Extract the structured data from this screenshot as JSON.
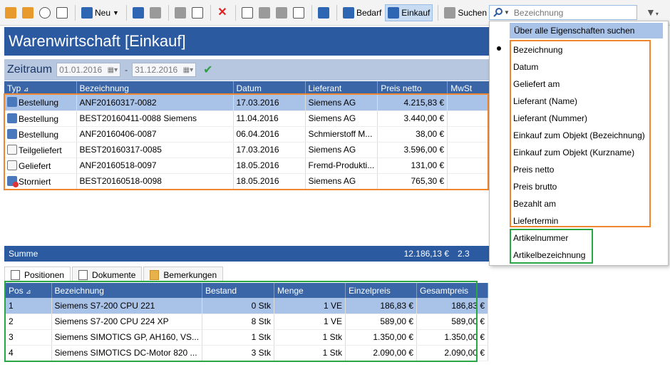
{
  "toolbar": {
    "new_label": "Neu",
    "bedarf_label": "Bedarf",
    "einkauf_label": "Einkauf",
    "suchen_label": "Suchen",
    "search_placeholder": "Bezeichnung"
  },
  "title": "Warenwirtschaft [Einkauf]",
  "zeitraum": {
    "label": "Zeitraum",
    "from": "01.01.2016",
    "to": "31.12.2016"
  },
  "table": {
    "columns": [
      "Typ",
      "Bezeichnung",
      "Datum",
      "Lieferant",
      "Preis netto",
      "MwSt"
    ],
    "rows": [
      {
        "typ": "Bestellung",
        "bezeichnung": "ANF20160317-0082",
        "datum": "17.03.2016",
        "lieferant": "Siemens AG",
        "preis": "4.215,83 €",
        "mwst": ""
      },
      {
        "typ": "Bestellung",
        "bezeichnung": "BEST20160411-0088 Siemens",
        "datum": "11.04.2016",
        "lieferant": "Siemens AG",
        "preis": "3.440,00 €",
        "mwst": ""
      },
      {
        "typ": "Bestellung",
        "bezeichnung": "ANF20160406-0087",
        "datum": "06.04.2016",
        "lieferant": "Schmierstoff M...",
        "preis": "38,00 €",
        "mwst": ""
      },
      {
        "typ": "Teilgeliefert",
        "bezeichnung": "BEST20160317-0085",
        "datum": "17.03.2016",
        "lieferant": "Siemens AG",
        "preis": "3.596,00 €",
        "mwst": ""
      },
      {
        "typ": "Geliefert",
        "bezeichnung": "ANF20160518-0097",
        "datum": "18.05.2016",
        "lieferant": "Fremd-Produkti...",
        "preis": "131,00 €",
        "mwst": ""
      },
      {
        "typ": "Storniert",
        "bezeichnung": "BEST20160518-0098",
        "datum": "18.05.2016",
        "lieferant": "Siemens AG",
        "preis": "765,30 €",
        "mwst": ""
      }
    ]
  },
  "summe": {
    "label": "Summe",
    "value": "12.186,13 €",
    "mwst": "2.3"
  },
  "tabs": [
    "Positionen",
    "Dokumente",
    "Bemerkungen"
  ],
  "positions": {
    "columns": [
      "Pos",
      "Bezeichnung",
      "Bestand",
      "Menge",
      "Einzelpreis",
      "Gesamtpreis"
    ],
    "rows": [
      {
        "pos": "1",
        "bezeichnung": "Siemens S7-200 CPU 221",
        "bestand": "0 Stk",
        "menge": "1 VE",
        "einzel": "186,83 €",
        "gesamt": "186,83 €"
      },
      {
        "pos": "2",
        "bezeichnung": "Siemens S7-200 CPU 224 XP",
        "bestand": "8 Stk",
        "menge": "1 VE",
        "einzel": "589,00 €",
        "gesamt": "589,00 €"
      },
      {
        "pos": "3",
        "bezeichnung": "Siemens SIMOTICS GP, AH160, VS...",
        "bestand": "1 Stk",
        "menge": "1 Stk",
        "einzel": "1.350,00 €",
        "gesamt": "1.350,00 €"
      },
      {
        "pos": "4",
        "bezeichnung": "Siemens SIMOTICS DC-Motor 820 ...",
        "bestand": "3 Stk",
        "menge": "1 Stk",
        "einzel": "2.090,00 €",
        "gesamt": "2.090,00 €"
      }
    ]
  },
  "dropdown": {
    "header": "Über alle Eigenschaften suchen",
    "items": [
      "Bezeichnung",
      "Datum",
      "Geliefert am",
      "Lieferant (Name)",
      "Lieferant (Nummer)",
      "Einkauf zum Objekt (Bezeichnung)",
      "Einkauf zum Objekt (Kurzname)",
      "Preis netto",
      "Preis brutto",
      "Bezahlt am",
      "Liefertermin",
      "Artikelnummer",
      "Artikelbezeichnung"
    ]
  },
  "colors": {
    "header_blue": "#2c5aa0",
    "selection": "#a9c2e7",
    "highlight_orange": "#f0862d",
    "highlight_green": "#2aa745"
  }
}
